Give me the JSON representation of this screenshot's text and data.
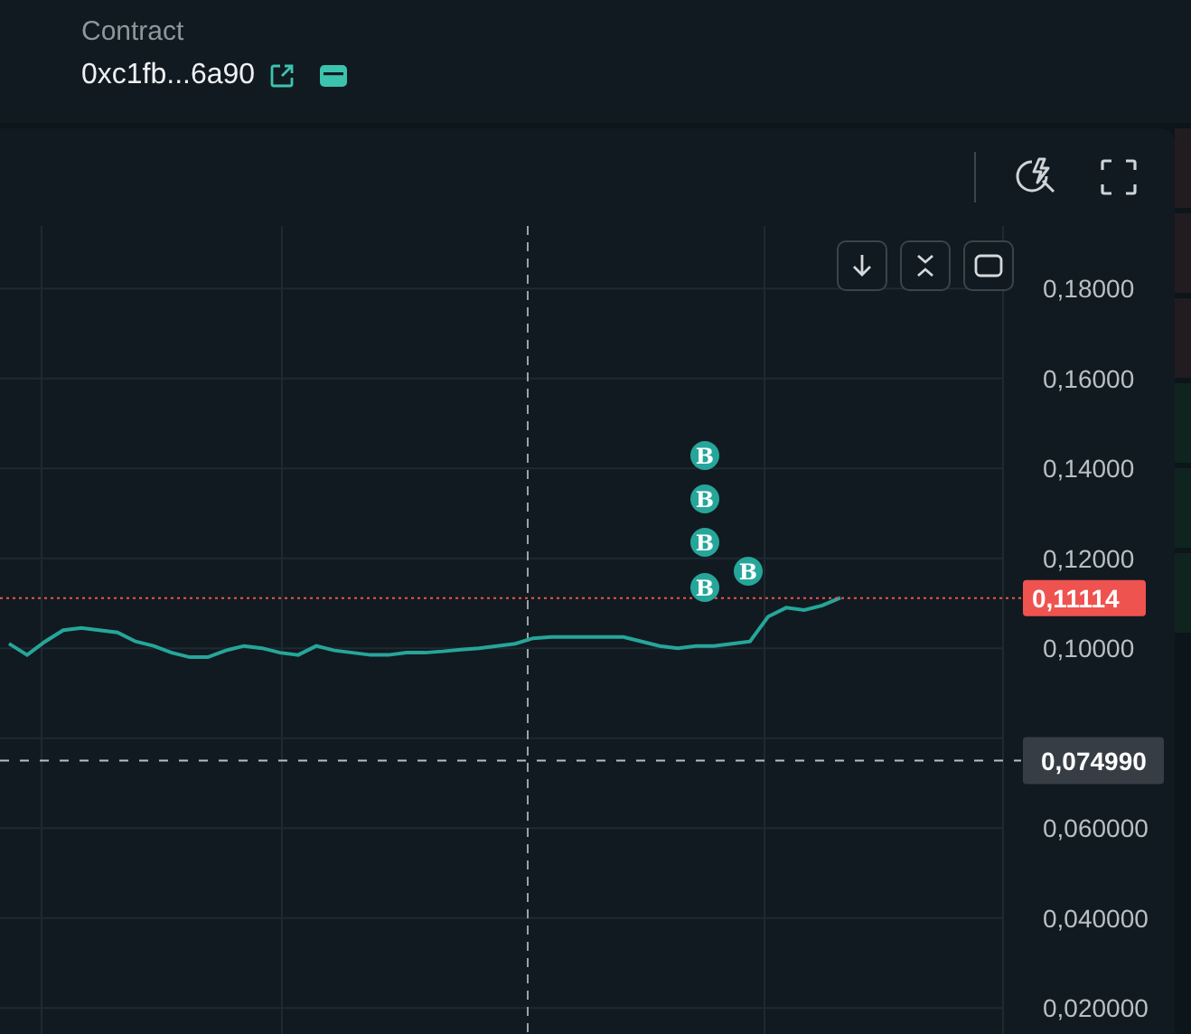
{
  "header": {
    "contract_label": "Contract",
    "contract_value": "0xc1fb...6a90"
  },
  "chart": {
    "markers": [
      {
        "label": "B"
      },
      {
        "label": "B"
      },
      {
        "label": "B"
      },
      {
        "label": "B"
      },
      {
        "label": "B"
      }
    ],
    "chart_data": {
      "type": "line",
      "grid": true,
      "ylim": [
        0.0142,
        0.1939
      ],
      "yticks": [
        {
          "value": 0.18,
          "label": "0,18000"
        },
        {
          "value": 0.16,
          "label": "0,16000"
        },
        {
          "value": 0.14,
          "label": "0,14000"
        },
        {
          "value": 0.12,
          "label": "0,12000"
        },
        {
          "value": 0.1,
          "label": "0,10000"
        },
        {
          "value": 0.06,
          "label": "0,060000"
        },
        {
          "value": 0.04,
          "label": "0,040000"
        },
        {
          "value": 0.02,
          "label": "0,020000"
        }
      ],
      "ref_lines": [
        {
          "axis": "y",
          "value": 0.11114,
          "label": "0,11114",
          "color": "#ef5350"
        },
        {
          "axis": "y",
          "value": 0.07499,
          "label": "0,074990",
          "color": "#b8bfc4"
        }
      ],
      "series": [
        {
          "color": "#26a69a",
          "values": [
            0.101,
            0.0985,
            0.1015,
            0.104,
            0.1045,
            0.104,
            0.1035,
            0.1015,
            0.1005,
            0.099,
            0.098,
            0.098,
            0.0995,
            0.1005,
            0.1,
            0.099,
            0.0985,
            0.1005,
            0.0995,
            0.099,
            0.0985,
            0.0985,
            0.099,
            0.099,
            0.0993,
            0.0997,
            0.1,
            0.1005,
            0.101,
            0.1022,
            0.1025,
            0.1025,
            0.1025,
            0.1025,
            0.1025,
            0.1015,
            0.1005,
            0.1,
            0.1005,
            0.1005,
            0.101,
            0.1015,
            0.107,
            0.109,
            0.1085,
            0.1095,
            0.1112
          ]
        }
      ]
    }
  }
}
